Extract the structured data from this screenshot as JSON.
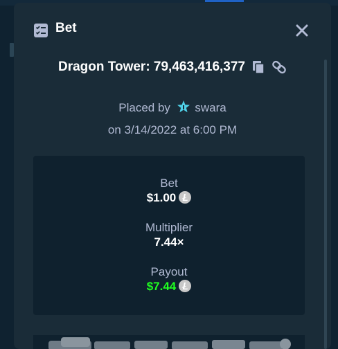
{
  "modal": {
    "title": "Bet",
    "game_line": "Dragon Tower: 79,463,416,377",
    "placed_prefix": "Placed by",
    "username": "swara",
    "date_line": "on 3/14/2022 at 6:00 PM"
  },
  "stats": {
    "bet_label": "Bet",
    "bet_value": "$1.00",
    "multiplier_label": "Multiplier",
    "multiplier_value": "7.44×",
    "payout_label": "Payout",
    "payout_value": "$7.44"
  },
  "colors": {
    "modal_bg": "#1a2c38",
    "panel_bg": "#0f212e",
    "text_primary": "#ffffff",
    "text_secondary": "#b1bad3",
    "payout_green": "#1fff20",
    "vip_star": "#4fd1e8"
  },
  "icons": [
    "bet-icon",
    "close-icon",
    "copy-icon",
    "link-icon",
    "vip-star-icon",
    "litecoin-icon"
  ]
}
